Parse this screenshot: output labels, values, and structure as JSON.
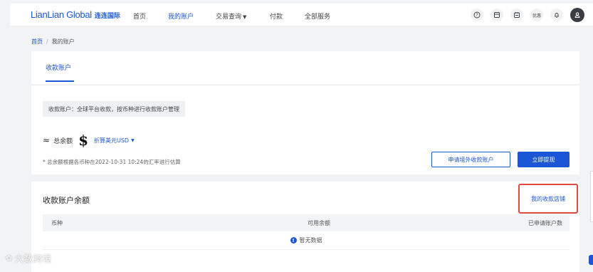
{
  "brand": {
    "name_en": "LianLian Global",
    "name_cn": "连连国际",
    "accent_color": "#1a56d6"
  },
  "nav": {
    "items": [
      {
        "label": "首页",
        "active": false
      },
      {
        "label": "我的账户",
        "active": true
      },
      {
        "label": "交易查询",
        "active": false,
        "has_dropdown": true
      },
      {
        "label": "付款",
        "active": false
      },
      {
        "label": "全部服务",
        "active": false
      }
    ],
    "icons": [
      {
        "name": "help-icon",
        "label": "?"
      },
      {
        "name": "document-icon",
        "label": ""
      },
      {
        "name": "calendar-icon",
        "label": ""
      },
      {
        "name": "discount-icon",
        "label": "优惠"
      },
      {
        "name": "bell-icon",
        "label": ""
      },
      {
        "name": "user-avatar-icon",
        "label": ""
      }
    ]
  },
  "breadcrumb": {
    "home": "首页",
    "separator": "/",
    "current": "我的账户"
  },
  "tabs": {
    "active": "收款账户"
  },
  "account": {
    "notice": "收款账户：全球平台收款，按币种进行收款账户管理",
    "approx_symbol": "≈",
    "total_label": "总余额",
    "currency_symbol": "$",
    "currency_selector": "折算美元USD",
    "footnote": "* 总余额根据各币种在2022-10-31 10:24的汇率进行估算",
    "apply_button": "申请境外收款账户",
    "withdraw_button": "立即提现"
  },
  "balance": {
    "title": "收款账户余额",
    "store_link": "我的收款店铺",
    "highlight_color": "#e04a3f",
    "columns": [
      "币种",
      "可用余额",
      "已申请账户数"
    ],
    "empty_text": "暂无数据"
  },
  "watermark": {
    "text": "大数跨境"
  }
}
